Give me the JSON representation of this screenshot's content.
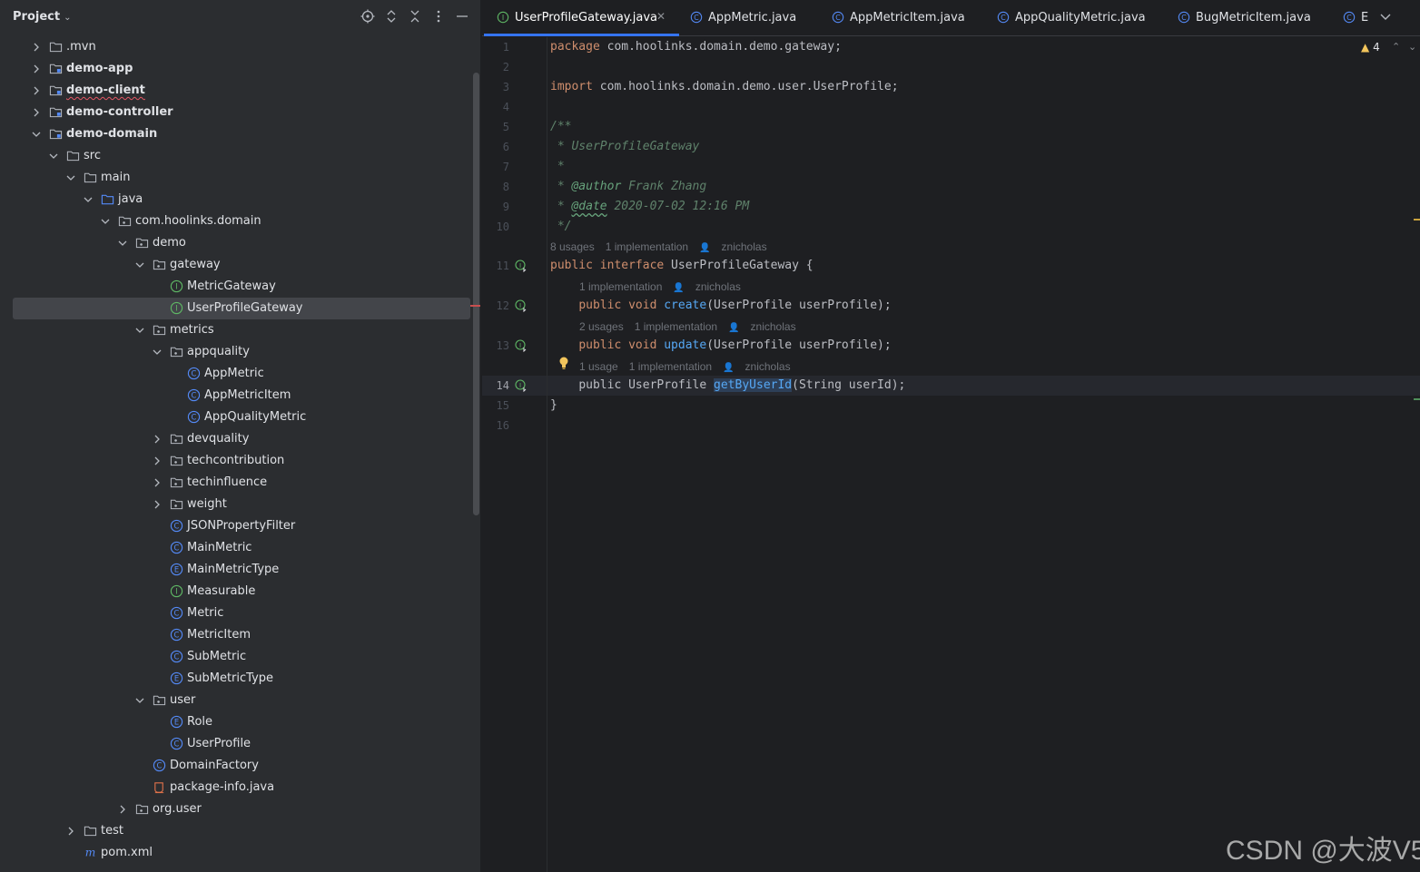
{
  "project_panel": {
    "title": "Project",
    "tree": [
      {
        "label": ".mvn",
        "depth": 0,
        "kind": "folder",
        "arrow": "right",
        "module": false
      },
      {
        "label": "demo-app",
        "depth": 0,
        "kind": "module",
        "arrow": "right",
        "module": true
      },
      {
        "label": "demo-client",
        "depth": 0,
        "kind": "module",
        "arrow": "right",
        "module": true,
        "squiggle": true
      },
      {
        "label": "demo-controller",
        "depth": 0,
        "kind": "module",
        "arrow": "right",
        "module": true
      },
      {
        "label": "demo-domain",
        "depth": 0,
        "kind": "module",
        "arrow": "down",
        "module": true
      },
      {
        "label": "src",
        "depth": 1,
        "kind": "folder",
        "arrow": "down"
      },
      {
        "label": "main",
        "depth": 2,
        "kind": "folder",
        "arrow": "down"
      },
      {
        "label": "java",
        "depth": 3,
        "kind": "source-folder",
        "arrow": "down"
      },
      {
        "label": "com.hoolinks.domain",
        "depth": 4,
        "kind": "package",
        "arrow": "down"
      },
      {
        "label": "demo",
        "depth": 5,
        "kind": "package",
        "arrow": "down"
      },
      {
        "label": "gateway",
        "depth": 6,
        "kind": "package",
        "arrow": "down"
      },
      {
        "label": "MetricGateway",
        "depth": 7,
        "kind": "interface",
        "arrow": "none"
      },
      {
        "label": "UserProfileGateway",
        "depth": 7,
        "kind": "interface",
        "arrow": "none",
        "selected": true
      },
      {
        "label": "metrics",
        "depth": 6,
        "kind": "package",
        "arrow": "down"
      },
      {
        "label": "appquality",
        "depth": 7,
        "kind": "package",
        "arrow": "down"
      },
      {
        "label": "AppMetric",
        "depth": 8,
        "kind": "class",
        "arrow": "none"
      },
      {
        "label": "AppMetricItem",
        "depth": 8,
        "kind": "class",
        "arrow": "none"
      },
      {
        "label": "AppQualityMetric",
        "depth": 8,
        "kind": "class",
        "arrow": "none"
      },
      {
        "label": "devquality",
        "depth": 7,
        "kind": "package",
        "arrow": "right"
      },
      {
        "label": "techcontribution",
        "depth": 7,
        "kind": "package",
        "arrow": "right"
      },
      {
        "label": "techinfluence",
        "depth": 7,
        "kind": "package",
        "arrow": "right"
      },
      {
        "label": "weight",
        "depth": 7,
        "kind": "package",
        "arrow": "right"
      },
      {
        "label": "JSONPropertyFilter",
        "depth": 7,
        "kind": "class",
        "arrow": "none"
      },
      {
        "label": "MainMetric",
        "depth": 7,
        "kind": "class",
        "arrow": "none"
      },
      {
        "label": "MainMetricType",
        "depth": 7,
        "kind": "enum",
        "arrow": "none"
      },
      {
        "label": "Measurable",
        "depth": 7,
        "kind": "interface",
        "arrow": "none"
      },
      {
        "label": "Metric",
        "depth": 7,
        "kind": "class",
        "arrow": "none"
      },
      {
        "label": "MetricItem",
        "depth": 7,
        "kind": "class",
        "arrow": "none"
      },
      {
        "label": "SubMetric",
        "depth": 7,
        "kind": "class",
        "arrow": "none"
      },
      {
        "label": "SubMetricType",
        "depth": 7,
        "kind": "enum",
        "arrow": "none"
      },
      {
        "label": "user",
        "depth": 6,
        "kind": "package",
        "arrow": "down"
      },
      {
        "label": "Role",
        "depth": 7,
        "kind": "enum",
        "arrow": "none"
      },
      {
        "label": "UserProfile",
        "depth": 7,
        "kind": "class",
        "arrow": "none"
      },
      {
        "label": "DomainFactory",
        "depth": 6,
        "kind": "class",
        "arrow": "none"
      },
      {
        "label": "package-info.java",
        "depth": 6,
        "kind": "java-file",
        "arrow": "none"
      },
      {
        "label": "org.user",
        "depth": 5,
        "kind": "package",
        "arrow": "right"
      },
      {
        "label": "test",
        "depth": 2,
        "kind": "folder",
        "arrow": "right"
      },
      {
        "label": "pom.xml",
        "depth": 2,
        "kind": "maven",
        "arrow": "none"
      }
    ]
  },
  "tabs": [
    {
      "label": "UserProfileGateway.java",
      "kind": "interface",
      "active": true,
      "closable": true
    },
    {
      "label": "AppMetric.java",
      "kind": "class"
    },
    {
      "label": "AppMetricItem.java",
      "kind": "class"
    },
    {
      "label": "AppQualityMetric.java",
      "kind": "class"
    },
    {
      "label": "BugMetricItem.java",
      "kind": "class"
    },
    {
      "label": "E",
      "kind": "class"
    }
  ],
  "editor": {
    "warnings_count": "4",
    "line_numbers": [
      "1",
      "2",
      "3",
      "4",
      "5",
      "6",
      "7",
      "8",
      "9",
      "10",
      "11",
      "12",
      "13",
      "14",
      "15",
      "16"
    ],
    "current_line": "14",
    "code": {
      "l1_kw": "package",
      "l1_rest": " com.hoolinks.domain.demo.gateway;",
      "l3_kw": "import",
      "l3_rest": " com.hoolinks.domain.demo.user.UserProfile;",
      "l5": "/**",
      "l6": " * UserProfileGateway",
      "l7": " *",
      "l8_star": " * ",
      "l8_tag": "@author",
      "l8_val": " Frank Zhang",
      "l9_star": " * ",
      "l9_tag": "@date",
      "l9_val": " 2020-07-02 12:16 PM",
      "l10": " */",
      "l11_kw": "public interface",
      "l11_rest": " UserProfileGateway {",
      "l12_indent": "    ",
      "l12_kw": "public void",
      "l12_fn": "create",
      "l12_rest": "(UserProfile userProfile);",
      "l13_indent": "    ",
      "l13_kw": "public void",
      "l13_fn": "update",
      "l13_rest": "(UserProfile userProfile);",
      "l14_indent": "    ",
      "l14_kw": "public",
      "l14_type": " UserProfile ",
      "l14_fn": "getByUserId",
      "l14_rest": "(String userId);",
      "l15": "}"
    },
    "inlays": {
      "i11": {
        "usages": "8 usages",
        "impl": "1 implementation",
        "author": "znicholas"
      },
      "i12": {
        "impl": "1 implementation",
        "author": "znicholas"
      },
      "i13": {
        "usages": "2 usages",
        "impl": "1 implementation",
        "author": "znicholas"
      },
      "i14": {
        "usages": "1 usage",
        "impl": "1 implementation",
        "author": "znicholas"
      }
    }
  },
  "watermark": "CSDN @大波V5",
  "colors": {
    "accent": "#3574f0",
    "class_icon": "#548af7",
    "interface_icon": "#5fb865",
    "keyword": "#cf8e6d",
    "comment": "#5f826b"
  }
}
